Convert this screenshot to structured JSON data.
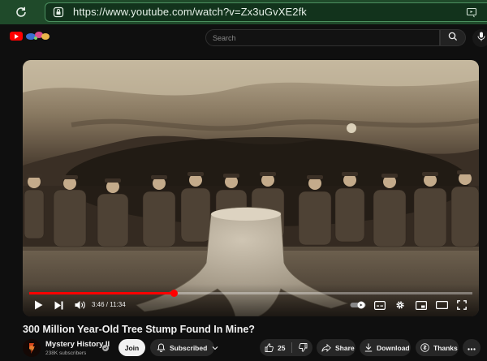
{
  "browser": {
    "url": "https://www.youtube.com/watch?v=Zx3uGvXE2fk"
  },
  "header": {
    "search_placeholder": "Search"
  },
  "player": {
    "current_time": "3:46",
    "duration": "11:34",
    "time_display": "3:46 / 11:34",
    "progress_fraction": 0.326,
    "accent_color": "#ff0000",
    "autoplay": true
  },
  "video": {
    "title": "300 Million Year-Old Tree Stump Found In Mine?"
  },
  "channel": {
    "name": "Mystery History II",
    "subscribers": "238K subscribers",
    "verified": true
  },
  "actions": {
    "join_label": "Join",
    "subscribe_label": "Subscribed",
    "likes_count": "25",
    "share_label": "Share",
    "download_label": "Download",
    "thanks_label": "Thanks"
  },
  "icons": [
    "reload-icon",
    "lock-icon",
    "extension-icon",
    "youtube-logo",
    "search-icon",
    "mic-icon",
    "play-icon",
    "next-icon",
    "volume-icon",
    "autoplay-toggle",
    "subtitles-icon",
    "settings-icon",
    "miniplayer-icon",
    "theater-icon",
    "fullscreen-icon",
    "bell-icon",
    "chevron-down-icon",
    "like-icon",
    "dislike-icon",
    "share-icon",
    "download-icon",
    "thanks-icon",
    "more-icon"
  ]
}
